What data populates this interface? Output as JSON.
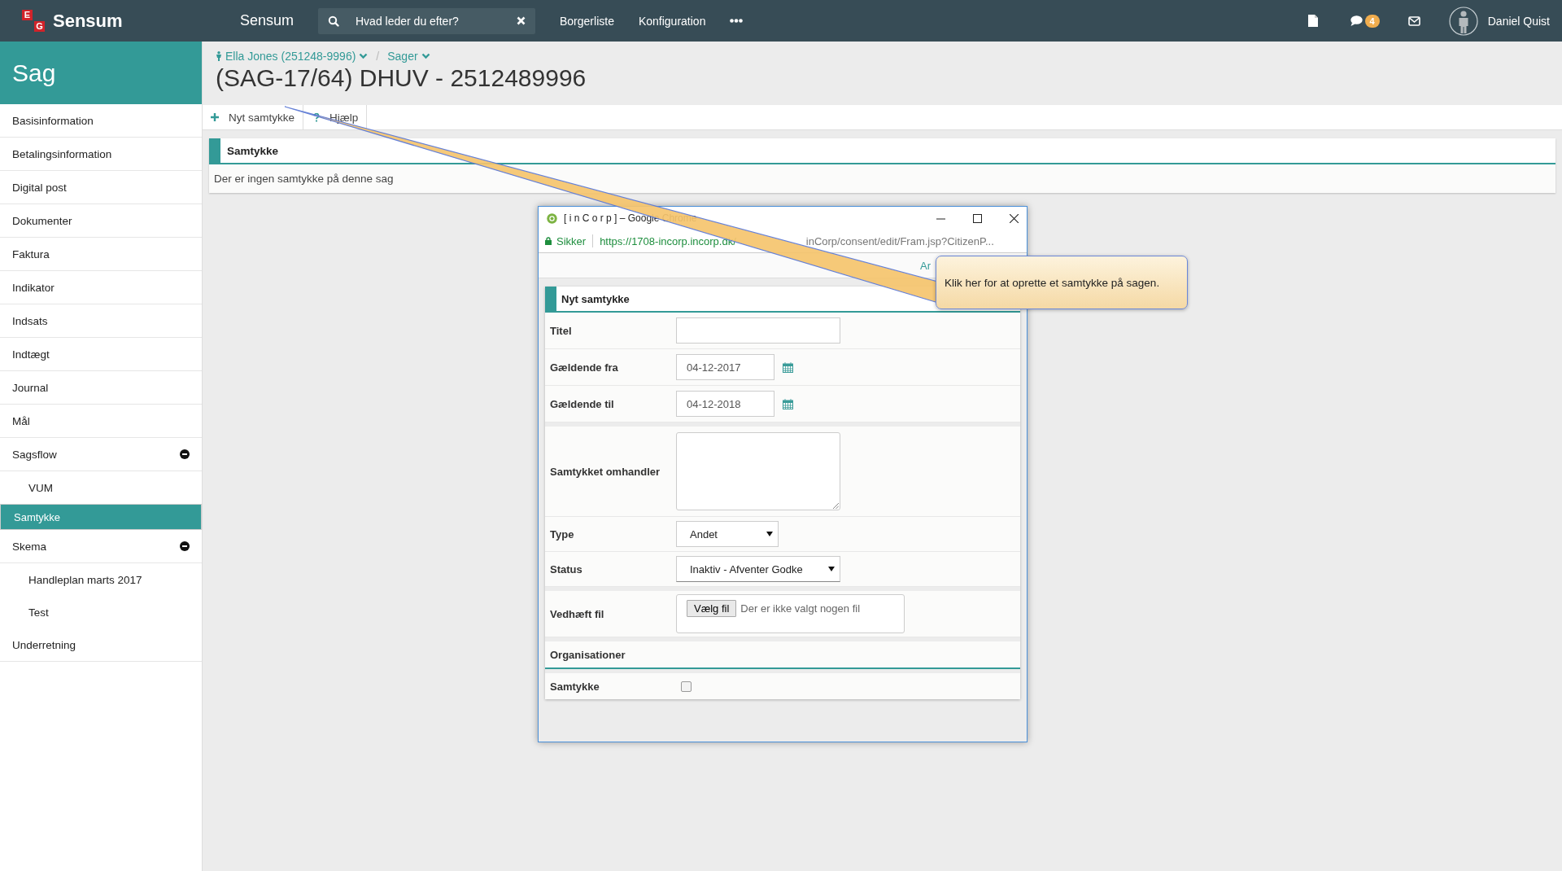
{
  "topbar": {
    "logo_letters": [
      "E",
      "G"
    ],
    "brand": "Sensum",
    "app_name": "Sensum",
    "search": {
      "placeholder": "Hvad leder du efter?"
    },
    "nav": [
      "Borgerliste",
      "Konfiguration"
    ],
    "message_count": "4",
    "user": "Daniel Quist"
  },
  "sidebar": {
    "title": "Sag",
    "items": [
      {
        "label": "Basisinformation",
        "selected": false
      },
      {
        "label": "Betalingsinformation",
        "selected": false
      },
      {
        "label": "Digital post",
        "selected": false
      },
      {
        "label": "Dokumenter",
        "selected": false
      },
      {
        "label": "Faktura",
        "selected": false
      },
      {
        "label": "Indikator",
        "selected": false
      },
      {
        "label": "Indsats",
        "selected": false
      },
      {
        "label": "Indtægt",
        "selected": false
      },
      {
        "label": "Journal",
        "selected": false
      },
      {
        "label": "Mål",
        "selected": false
      },
      {
        "label": "Sagsflow",
        "selected": false,
        "expanded": true,
        "children": [
          {
            "label": "VUM",
            "selected": false
          }
        ]
      },
      {
        "label": "Samtykke",
        "selected": true
      },
      {
        "label": "Skema",
        "selected": false,
        "expanded": true,
        "children": [
          {
            "label": "Handleplan marts 2017",
            "selected": false
          },
          {
            "label": "Test",
            "selected": false
          }
        ]
      },
      {
        "label": "Underretning",
        "selected": false
      }
    ]
  },
  "breadcrumb": {
    "items": [
      {
        "label": "Ella Jones (251248-9996)",
        "kind": "person"
      },
      {
        "label": "Sager",
        "kind": "plain"
      }
    ],
    "separator": "/"
  },
  "title": "(SAG-17/64) DHUV - 2512489996",
  "actions": [
    {
      "label": "Nyt samtykke",
      "kind": "add"
    },
    {
      "label": "Hjælp",
      "kind": "help"
    }
  ],
  "panel": {
    "title": "Samtykke",
    "empty_text": "Der er ingen samtykke på denne sag"
  },
  "popup": {
    "title": "[ i n C o r p ] – Google Chrome",
    "secure_label": "Sikker",
    "url_host": "https://1708-incorp.incorp.dk/",
    "url_tail": "inCorp/consent/edit/Fram.jsp?CitizenP...",
    "toolbar_text": "Ar",
    "form": {
      "title": "Nyt samtykke",
      "fields": [
        {
          "kind": "text",
          "label": "Titel"
        },
        {
          "kind": "date",
          "label": "Gældende fra",
          "value": "04-12-2017"
        },
        {
          "kind": "date",
          "label": "Gældende til",
          "value": "04-12-2018"
        },
        {
          "kind": "textarea",
          "label": "Samtykket omhandler"
        },
        {
          "kind": "select",
          "label": "Type",
          "value": "Andet"
        },
        {
          "kind": "select",
          "label": "Status",
          "value": "Inaktiv - Afventer Godke"
        },
        {
          "kind": "file",
          "label": "Vedhæft fil",
          "button": "Vælg fil",
          "value": "Der er ikke valgt nogen fil"
        },
        {
          "kind": "section",
          "label": "Organisationer"
        },
        {
          "kind": "checkbox",
          "label": "Samtykke",
          "checked": false
        }
      ]
    }
  },
  "callout": {
    "text": "Klik her for at oprette et samtykke på sagen."
  }
}
